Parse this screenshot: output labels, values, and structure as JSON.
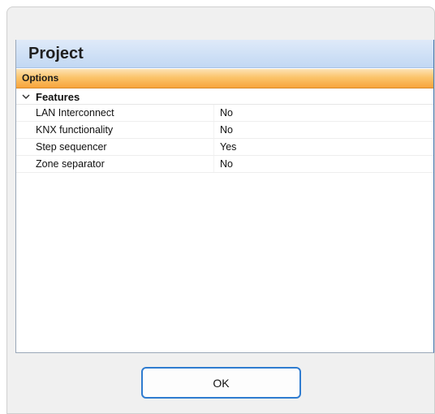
{
  "header": {
    "title": "Project"
  },
  "options_bar": {
    "label": "Options"
  },
  "category": {
    "label": "Features",
    "expanded": true,
    "icon": "chevron-down-icon"
  },
  "properties": [
    {
      "name": "LAN Interconnect",
      "value": "No"
    },
    {
      "name": "KNX functionality",
      "value": "No"
    },
    {
      "name": "Step sequencer",
      "value": "Yes"
    },
    {
      "name": "Zone separator",
      "value": "No"
    }
  ],
  "footer": {
    "ok_label": "OK"
  },
  "colors": {
    "header_bg": "#c2d8f3",
    "options_bar": "#fbc46b",
    "ok_border": "#2f7cd0"
  }
}
